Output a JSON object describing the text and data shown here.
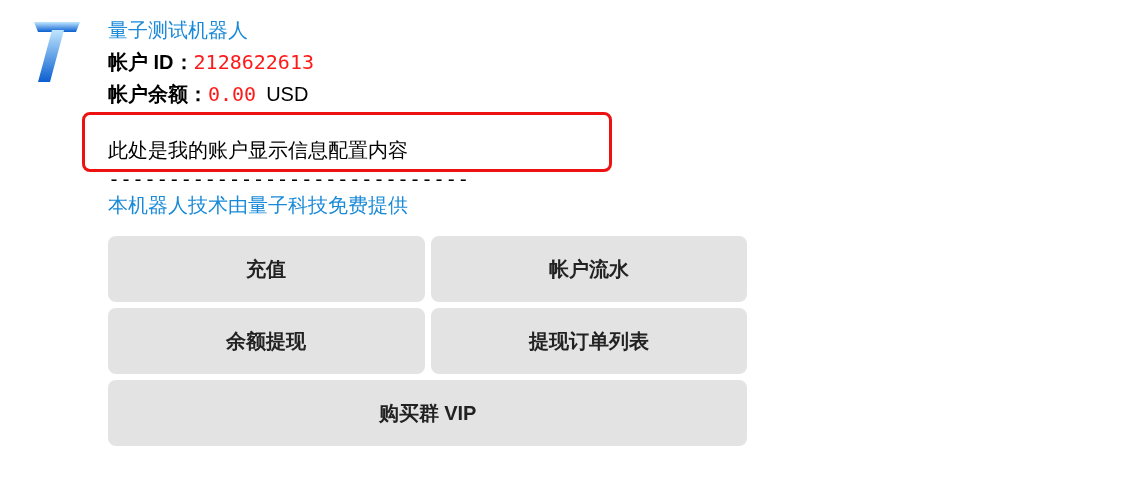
{
  "bot_name": "量子测试机器人",
  "account_id": {
    "label": "帐户 ID：",
    "value": "2128622613"
  },
  "balance": {
    "label": "帐户余额：",
    "value": "0.00",
    "currency": "USD"
  },
  "info_text": {
    "text": "此处是我的账户显示信息配置内容",
    "highlighted": true
  },
  "divider": "------------------------------",
  "credit": "本机器人技术由量子科技免费提供",
  "button_rows": [
    [
      "充值",
      "帐户流水"
    ],
    [
      "余额提现",
      "提现订单列表"
    ],
    [
      "购买群 VIP"
    ]
  ]
}
